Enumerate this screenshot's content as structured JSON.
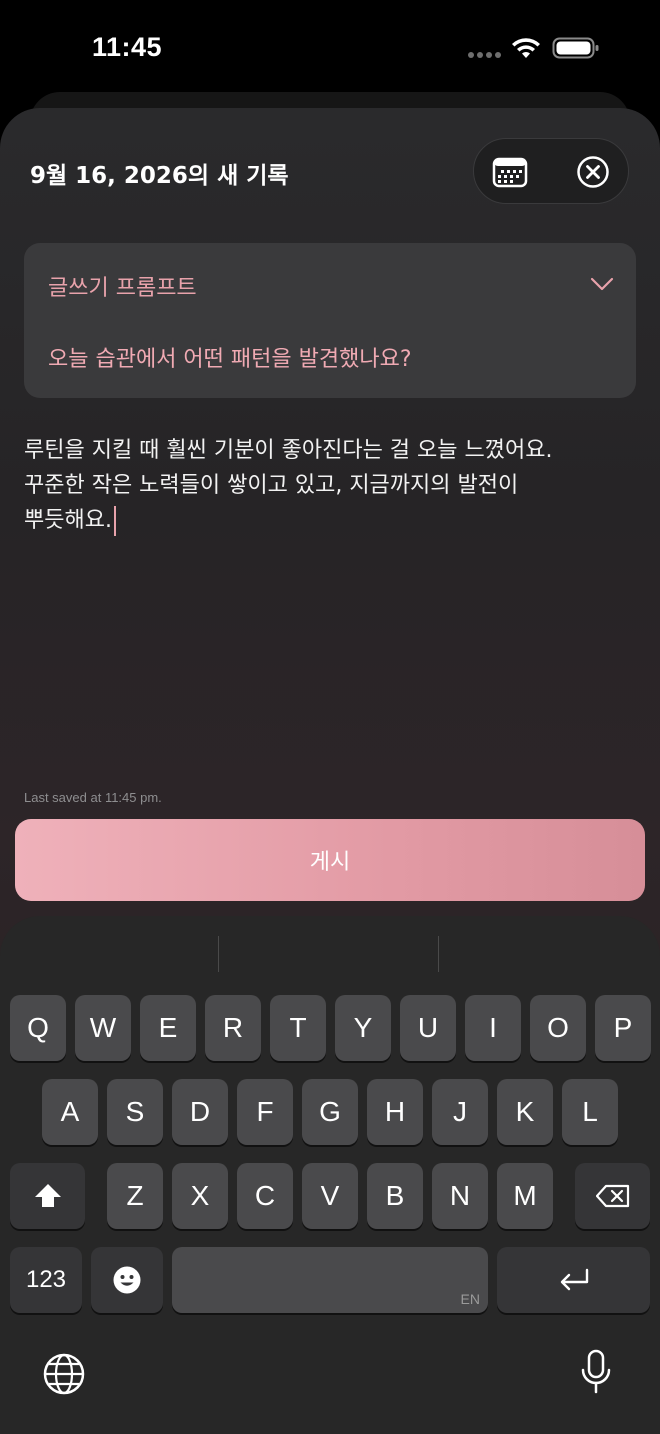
{
  "status": {
    "time": "11:45"
  },
  "sheet": {
    "title": "9월 16, 2026의 새 기록",
    "prompt": {
      "label": "글쓰기 프롬프트",
      "question": "오늘 습관에서 어떤 패턴을 발견했나요?"
    },
    "entry": {
      "line1": "루틴을 지킬 때 훨씬 기분이 좋아진다는 걸 오늘 느꼈어요.",
      "line2": "꾸준한 작은 노력들이 쌓이고 있고, 지금까지의 발전이",
      "line3": "뿌듯해요."
    },
    "saved": "Last saved at 11:45 pm.",
    "publish_label": "게시"
  },
  "keyboard": {
    "row1": [
      "Q",
      "W",
      "E",
      "R",
      "T",
      "Y",
      "U",
      "I",
      "O",
      "P"
    ],
    "row2": [
      "A",
      "S",
      "D",
      "F",
      "G",
      "H",
      "J",
      "K",
      "L"
    ],
    "row3": [
      "Z",
      "X",
      "C",
      "V",
      "B",
      "N",
      "M"
    ],
    "numbers_label": "123",
    "space_lang": "EN"
  },
  "colors": {
    "accent": "#e8a2ab",
    "button": "#e29aa4",
    "sheet": "#2a2a2c",
    "key": "#4a4a4c"
  },
  "icons": [
    "wifi-icon",
    "battery-icon",
    "calendar-icon",
    "close-icon",
    "chevron-down-icon",
    "shift-icon",
    "backspace-icon",
    "emoji-icon",
    "return-icon",
    "globe-icon",
    "mic-icon"
  ]
}
